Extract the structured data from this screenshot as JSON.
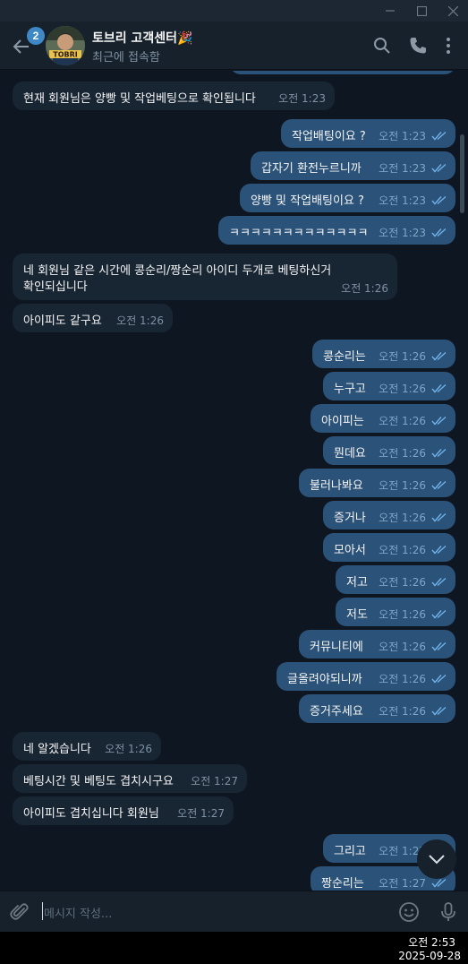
{
  "window": {
    "minimize": "—",
    "maximize": "☐",
    "close": "✕"
  },
  "header": {
    "unread_badge": "2",
    "avatar_text": "TOBRI",
    "title": "토브리 고객센터🎉",
    "status": "최근에 접속함"
  },
  "messages": [
    {
      "dir": "in",
      "lines": [
        "현재 회원님은 양빵 및 작업베팅으로 확인됩니다"
      ],
      "time": "오전 1:23"
    },
    {
      "dir": "out",
      "lines": [
        "작업배팅이요 ?"
      ],
      "time": "오전 1:23"
    },
    {
      "dir": "out",
      "lines": [
        "갑자기 환전누르니까"
      ],
      "time": "오전 1:23"
    },
    {
      "dir": "out",
      "lines": [
        "양빵 및 작업배팅이요 ?"
      ],
      "time": "오전 1:23"
    },
    {
      "dir": "out",
      "lines": [
        "ㅋㅋㅋㅋㅋㅋㅋㅋㅋㅋㅋㅋㅋ"
      ],
      "time": "오전 1:23"
    },
    {
      "dir": "in",
      "lines": [
        "네 회원님 같은 시간에 콩순리/짱순리 아이디 두개로 베팅하신거",
        "확인되십니다"
      ],
      "time": "오전 1:26"
    },
    {
      "dir": "in",
      "lines": [
        "아이피도 같구요"
      ],
      "time": "오전 1:26"
    },
    {
      "dir": "out",
      "lines": [
        "콩순리는"
      ],
      "time": "오전 1:26"
    },
    {
      "dir": "out",
      "lines": [
        "누구고"
      ],
      "time": "오전 1:26"
    },
    {
      "dir": "out",
      "lines": [
        "아이피는"
      ],
      "time": "오전 1:26"
    },
    {
      "dir": "out",
      "lines": [
        "뭔데요"
      ],
      "time": "오전 1:26"
    },
    {
      "dir": "out",
      "lines": [
        "불러나봐요"
      ],
      "time": "오전 1:26"
    },
    {
      "dir": "out",
      "lines": [
        "증거나"
      ],
      "time": "오전 1:26"
    },
    {
      "dir": "out",
      "lines": [
        "모아서"
      ],
      "time": "오전 1:26"
    },
    {
      "dir": "out",
      "lines": [
        "저고"
      ],
      "time": "오전 1:26"
    },
    {
      "dir": "out",
      "lines": [
        "저도"
      ],
      "time": "오전 1:26"
    },
    {
      "dir": "out",
      "lines": [
        "커뮤니티에"
      ],
      "time": "오전 1:26"
    },
    {
      "dir": "out",
      "lines": [
        "글올려야되니까"
      ],
      "time": "오전 1:26"
    },
    {
      "dir": "out",
      "lines": [
        "증거주세요"
      ],
      "time": "오전 1:26"
    },
    {
      "dir": "in",
      "lines": [
        "네 알겠습니다"
      ],
      "time": "오전 1:26"
    },
    {
      "dir": "in",
      "lines": [
        "베팅시간 및 베팅도 겹치시구요"
      ],
      "time": "오전 1:27"
    },
    {
      "dir": "in",
      "lines": [
        "아이피도 겹치십니다 회원님"
      ],
      "time": "오전 1:27"
    },
    {
      "dir": "out",
      "lines": [
        "그리고"
      ],
      "time": "오전 1:27"
    },
    {
      "dir": "out",
      "lines": [
        "짱순리는"
      ],
      "time": "오전 1:27"
    }
  ],
  "composer": {
    "placeholder": "메시지 작성..."
  },
  "taskbar": {
    "time": "오전 2:53",
    "date": "2025-09-28"
  },
  "colors": {
    "incoming_bubble": "#182533",
    "outgoing_bubble": "#2b5278",
    "background": "#0e1621",
    "accent": "#3e88c6"
  },
  "icons": [
    "back-arrow-icon",
    "search-icon",
    "phone-icon",
    "more-vertical-icon",
    "attach-icon",
    "emoji-icon",
    "microphone-icon",
    "chevron-down-icon",
    "double-check-icon"
  ]
}
